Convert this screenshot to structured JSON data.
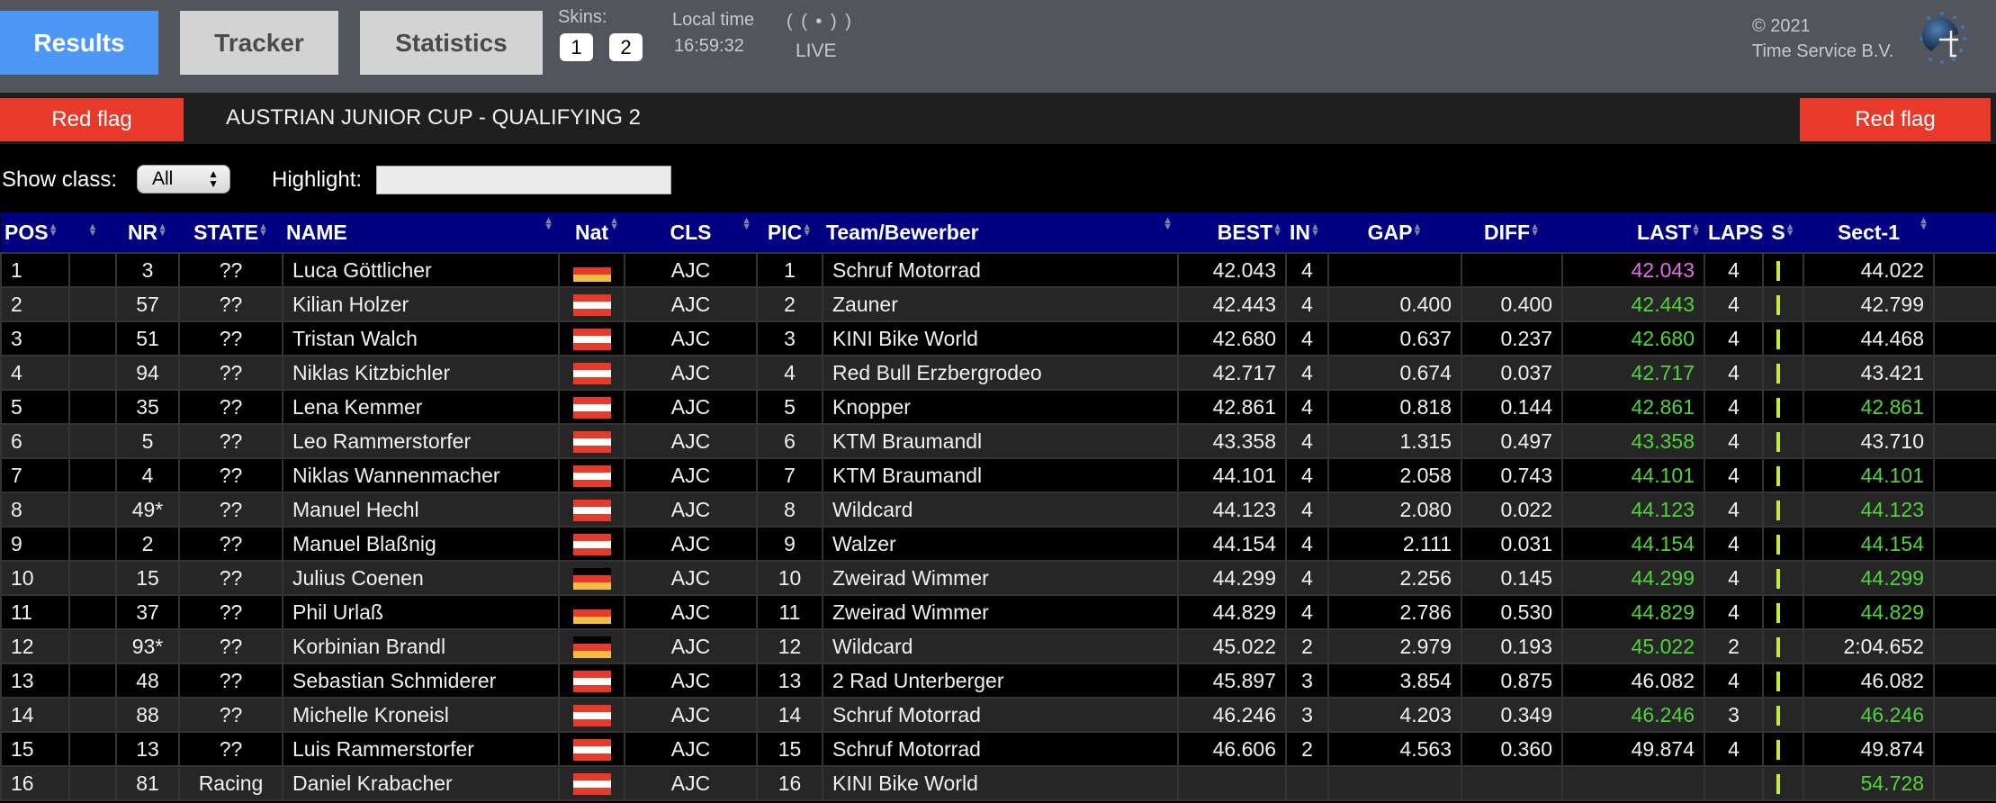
{
  "topbar": {
    "tabs": [
      {
        "label": "Results",
        "active": true
      },
      {
        "label": "Tracker",
        "active": false
      },
      {
        "label": "Statistics",
        "active": false
      }
    ],
    "skins_label": "Skins:",
    "skins": [
      "1",
      "2"
    ],
    "local_time_label": "Local time",
    "local_time": "16:59:32",
    "live_icon": "( ( • ) )",
    "live_label": "LIVE",
    "copyright_line1": "© 2021",
    "copyright_line2": "Time Service B.V.",
    "logo_icon": "time-service-logo"
  },
  "session": {
    "flag_left": "Red flag",
    "flag_right": "Red flag",
    "title": "AUSTRIAN JUNIOR CUP - QUALIFYING 2",
    "flag_color": "#e8392a"
  },
  "filters": {
    "show_class_label": "Show class:",
    "show_class_value": "All",
    "highlight_label": "Highlight:",
    "highlight_value": "",
    "highlight_placeholder": ""
  },
  "colors": {
    "header_bg": "#000080",
    "personal_best": "#52d33c",
    "overall_best": "#e56de6",
    "sector_indicator": "#c6ea3a"
  },
  "table": {
    "columns": [
      "POS",
      "",
      "NR",
      "STATE",
      "NAME",
      "Nat",
      "CLS",
      "PIC",
      "Team/Bewerber",
      "BEST",
      "IN",
      "GAP",
      "DIFF",
      "LAST",
      "LAPS",
      "S",
      "Sect-1",
      ""
    ],
    "rows": [
      {
        "pos": "1",
        "nr": "3",
        "state": "??",
        "name": "Luca Göttlicher",
        "nat": "de",
        "cls": "AJC",
        "pic": "1",
        "team": "Schruf Motorrad",
        "best": "42.043",
        "in": "4",
        "gap": "",
        "diff": "",
        "last": "42.043",
        "last_color": "purple",
        "laps": "4",
        "sect1": "44.022",
        "sect1_color": ""
      },
      {
        "pos": "2",
        "nr": "57",
        "state": "??",
        "name": "Kilian Holzer",
        "nat": "at",
        "cls": "AJC",
        "pic": "2",
        "team": "Zauner",
        "best": "42.443",
        "in": "4",
        "gap": "0.400",
        "diff": "0.400",
        "last": "42.443",
        "last_color": "green",
        "laps": "4",
        "sect1": "42.799",
        "sect1_color": ""
      },
      {
        "pos": "3",
        "nr": "51",
        "state": "??",
        "name": "Tristan Walch",
        "nat": "at",
        "cls": "AJC",
        "pic": "3",
        "team": "KINI Bike World",
        "best": "42.680",
        "in": "4",
        "gap": "0.637",
        "diff": "0.237",
        "last": "42.680",
        "last_color": "green",
        "laps": "4",
        "sect1": "44.468",
        "sect1_color": ""
      },
      {
        "pos": "4",
        "nr": "94",
        "state": "??",
        "name": "Niklas Kitzbichler",
        "nat": "at",
        "cls": "AJC",
        "pic": "4",
        "team": "Red Bull Erzbergrodeo",
        "best": "42.717",
        "in": "4",
        "gap": "0.674",
        "diff": "0.037",
        "last": "42.717",
        "last_color": "green",
        "laps": "4",
        "sect1": "43.421",
        "sect1_color": ""
      },
      {
        "pos": "5",
        "nr": "35",
        "state": "??",
        "name": "Lena Kemmer",
        "nat": "at",
        "cls": "AJC",
        "pic": "5",
        "team": "Knopper",
        "best": "42.861",
        "in": "4",
        "gap": "0.818",
        "diff": "0.144",
        "last": "42.861",
        "last_color": "green",
        "laps": "4",
        "sect1": "42.861",
        "sect1_color": "green"
      },
      {
        "pos": "6",
        "nr": "5",
        "state": "??",
        "name": "Leo Rammerstorfer",
        "nat": "at",
        "cls": "AJC",
        "pic": "6",
        "team": "KTM Braumandl",
        "best": "43.358",
        "in": "4",
        "gap": "1.315",
        "diff": "0.497",
        "last": "43.358",
        "last_color": "green",
        "laps": "4",
        "sect1": "43.710",
        "sect1_color": ""
      },
      {
        "pos": "7",
        "nr": "4",
        "state": "??",
        "name": "Niklas Wannenmacher",
        "nat": "at",
        "cls": "AJC",
        "pic": "7",
        "team": "KTM Braumandl",
        "best": "44.101",
        "in": "4",
        "gap": "2.058",
        "diff": "0.743",
        "last": "44.101",
        "last_color": "green",
        "laps": "4",
        "sect1": "44.101",
        "sect1_color": "green"
      },
      {
        "pos": "8",
        "nr": "49*",
        "state": "??",
        "name": "Manuel Hechl",
        "nat": "at",
        "cls": "AJC",
        "pic": "8",
        "team": "Wildcard",
        "best": "44.123",
        "in": "4",
        "gap": "2.080",
        "diff": "0.022",
        "last": "44.123",
        "last_color": "green",
        "laps": "4",
        "sect1": "44.123",
        "sect1_color": "green"
      },
      {
        "pos": "9",
        "nr": "2",
        "state": "??",
        "name": "Manuel Blaßnig",
        "nat": "at",
        "cls": "AJC",
        "pic": "9",
        "team": "Walzer",
        "best": "44.154",
        "in": "4",
        "gap": "2.111",
        "diff": "0.031",
        "last": "44.154",
        "last_color": "green",
        "laps": "4",
        "sect1": "44.154",
        "sect1_color": "green"
      },
      {
        "pos": "10",
        "nr": "15",
        "state": "??",
        "name": "Julius Coenen",
        "nat": "de",
        "cls": "AJC",
        "pic": "10",
        "team": "Zweirad Wimmer",
        "best": "44.299",
        "in": "4",
        "gap": "2.256",
        "diff": "0.145",
        "last": "44.299",
        "last_color": "green",
        "laps": "4",
        "sect1": "44.299",
        "sect1_color": "green"
      },
      {
        "pos": "11",
        "nr": "37",
        "state": "??",
        "name": "Phil Urlaß",
        "nat": "de",
        "cls": "AJC",
        "pic": "11",
        "team": "Zweirad Wimmer",
        "best": "44.829",
        "in": "4",
        "gap": "2.786",
        "diff": "0.530",
        "last": "44.829",
        "last_color": "green",
        "laps": "4",
        "sect1": "44.829",
        "sect1_color": "green"
      },
      {
        "pos": "12",
        "nr": "93*",
        "state": "??",
        "name": "Korbinian Brandl",
        "nat": "de",
        "cls": "AJC",
        "pic": "12",
        "team": "Wildcard",
        "best": "45.022",
        "in": "2",
        "gap": "2.979",
        "diff": "0.193",
        "last": "45.022",
        "last_color": "green",
        "laps": "2",
        "sect1": "2:04.652",
        "sect1_color": ""
      },
      {
        "pos": "13",
        "nr": "48",
        "state": "??",
        "name": "Sebastian Schmiderer",
        "nat": "at",
        "cls": "AJC",
        "pic": "13",
        "team": "2 Rad Unterberger",
        "best": "45.897",
        "in": "3",
        "gap": "3.854",
        "diff": "0.875",
        "last": "46.082",
        "last_color": "",
        "laps": "4",
        "sect1": "46.082",
        "sect1_color": ""
      },
      {
        "pos": "14",
        "nr": "88",
        "state": "??",
        "name": "Michelle Kroneisl",
        "nat": "at",
        "cls": "AJC",
        "pic": "14",
        "team": "Schruf Motorrad",
        "best": "46.246",
        "in": "3",
        "gap": "4.203",
        "diff": "0.349",
        "last": "46.246",
        "last_color": "green",
        "laps": "3",
        "sect1": "46.246",
        "sect1_color": "green"
      },
      {
        "pos": "15",
        "nr": "13",
        "state": "??",
        "name": "Luis Rammerstorfer",
        "nat": "at",
        "cls": "AJC",
        "pic": "15",
        "team": "Schruf Motorrad",
        "best": "46.606",
        "in": "2",
        "gap": "4.563",
        "diff": "0.360",
        "last": "49.874",
        "last_color": "",
        "laps": "4",
        "sect1": "49.874",
        "sect1_color": ""
      },
      {
        "pos": "16",
        "nr": "81",
        "state": "Racing",
        "name": "Daniel Krabacher",
        "nat": "at",
        "cls": "AJC",
        "pic": "16",
        "team": "KINI Bike World",
        "best": "",
        "in": "",
        "gap": "",
        "diff": "",
        "last": "",
        "last_color": "",
        "laps": "",
        "sect1": "54.728",
        "sect1_color": "green"
      }
    ]
  }
}
